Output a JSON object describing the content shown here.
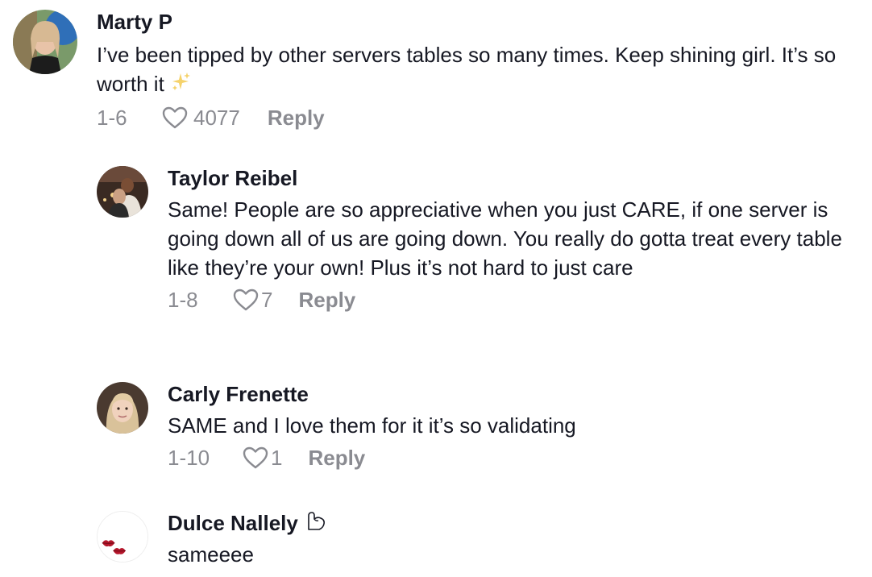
{
  "comments": [
    {
      "username": "Marty P",
      "text": "I’ve been tipped by other servers tables so many times. Keep shining girl. It’s so worth it",
      "emoji": "sparkles-icon",
      "date": "1-6",
      "likes": "4077",
      "reply_label": "Reply"
    },
    {
      "username": "Taylor Reibel",
      "text": "Same! People are so appreciative when you just CARE, if one server is going down all of us are going down. You really do gotta treat every table like they’re your own! Plus it’s not hard to just care",
      "date": "1-8",
      "likes": "7",
      "reply_label": "Reply"
    },
    {
      "username": "Carly Frenette",
      "text": "SAME and I love them for it it’s so validating",
      "date": "1-10",
      "likes": "1",
      "reply_label": "Reply"
    },
    {
      "username": "Dulce Nallely",
      "badge": "flexed-arm-icon",
      "text": "sameeee"
    }
  ],
  "colors": {
    "text": "#161823",
    "muted": "#8a8b91",
    "background": "#ffffff"
  }
}
